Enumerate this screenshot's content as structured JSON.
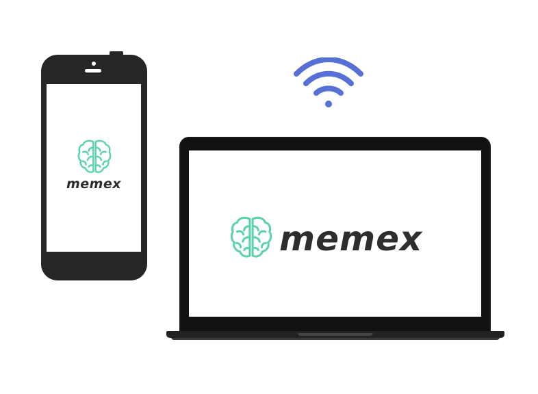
{
  "brand": {
    "name": "memex",
    "accent_color": "#5ed3a8",
    "text_color": "#2d2d2d"
  },
  "phone": {
    "logo_icon": "brain-icon",
    "wordmark": "memex"
  },
  "laptop": {
    "logo_icon": "brain-icon",
    "wordmark": "memex"
  },
  "connection": {
    "icon": "wifi-icon",
    "color": "#5770d6"
  },
  "colors": {
    "device_body": "#262626",
    "screen": "#ffffff",
    "background": "#ffffff"
  }
}
